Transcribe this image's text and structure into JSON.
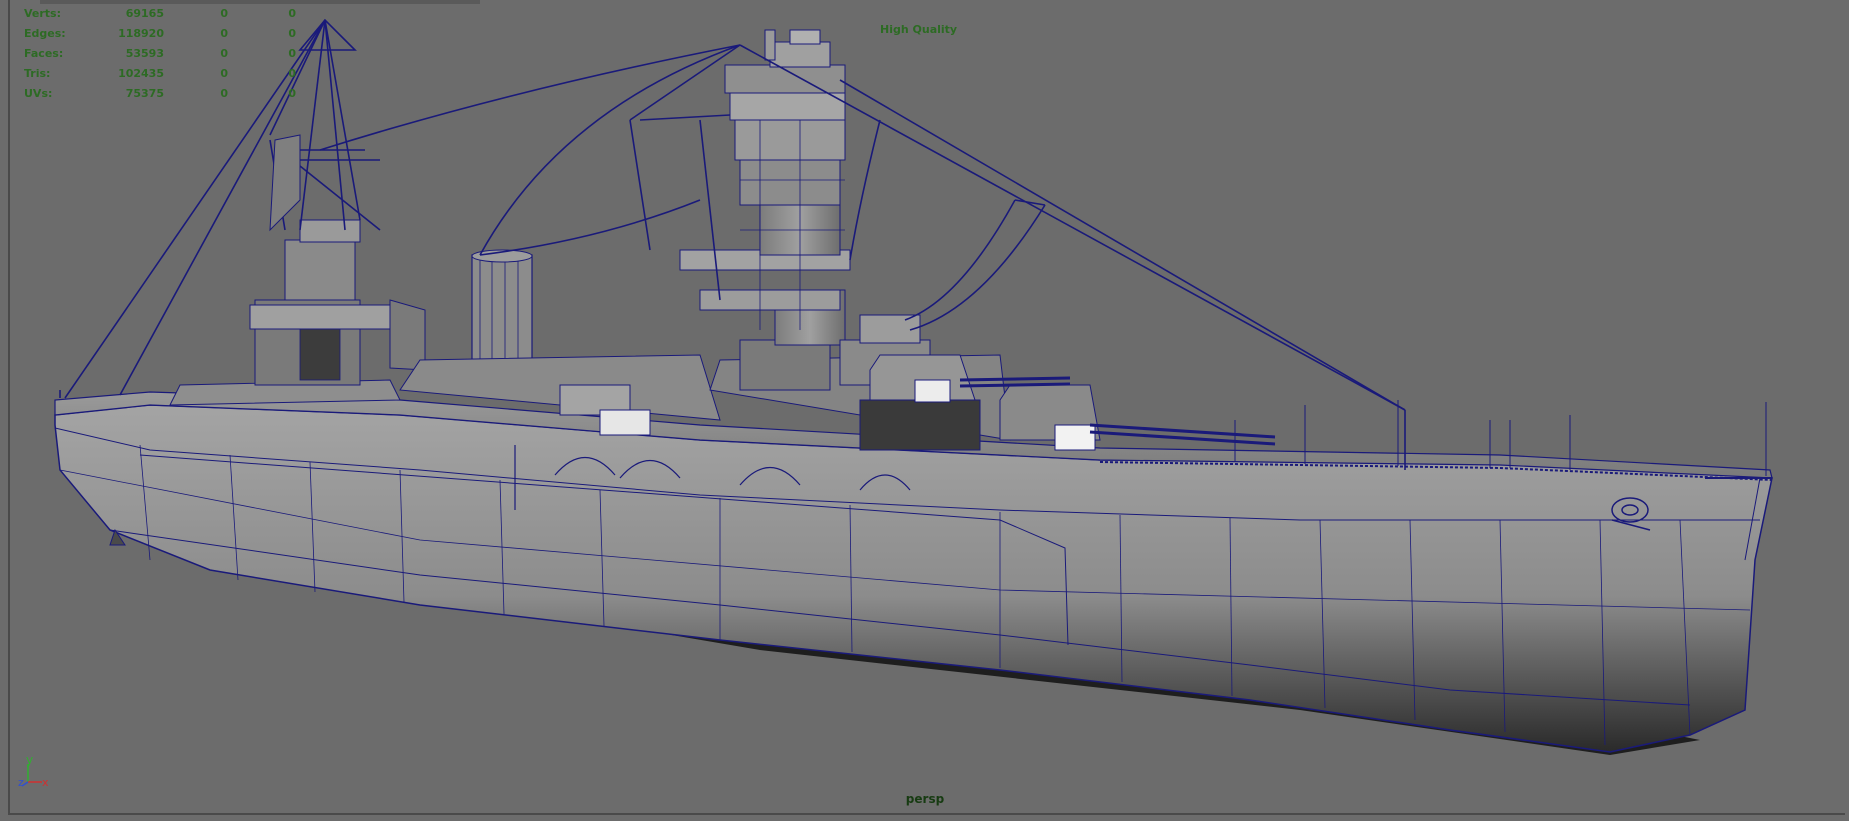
{
  "stats": {
    "rows": [
      {
        "label": "Verts:",
        "total": "69165",
        "selected": "0",
        "components": "0"
      },
      {
        "label": "Edges:",
        "total": "118920",
        "selected": "0",
        "components": "0"
      },
      {
        "label": "Faces:",
        "total": "53593",
        "selected": "0",
        "components": "0"
      },
      {
        "label": "Tris:",
        "total": "102435",
        "selected": "0",
        "components": "0"
      },
      {
        "label": "UVs:",
        "total": "75375",
        "selected": "0",
        "components": "0"
      }
    ]
  },
  "viewport": {
    "quality": "High Quality",
    "camera": "persp"
  },
  "axis": {
    "y": "y",
    "z": "z",
    "x": "x"
  },
  "colors": {
    "hud_text": "#2d6b24",
    "camera_text": "#173b12",
    "wireframe": "#1a1a7a",
    "viewport_bg": "#6c6c6c",
    "axis_x": "#d03030",
    "axis_y": "#30b030",
    "axis_z": "#3050d0"
  }
}
